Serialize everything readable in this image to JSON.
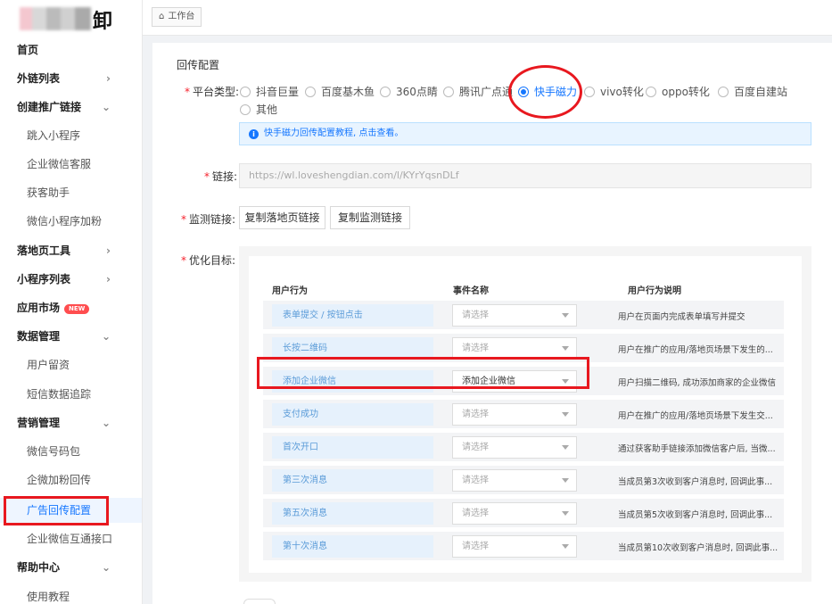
{
  "logo": {
    "text": "卸"
  },
  "header": {
    "breadcrumb_label": "工作台"
  },
  "sidebar": {
    "items": [
      {
        "label": "首页",
        "level": "top",
        "chevron": ""
      },
      {
        "label": "外链列表",
        "level": "top",
        "chevron": ">"
      },
      {
        "label": "创建推广链接",
        "level": "top",
        "chevron": "v"
      },
      {
        "label": "跳入小程序",
        "level": "sub"
      },
      {
        "label": "企业微信客服",
        "level": "sub"
      },
      {
        "label": "获客助手",
        "level": "sub"
      },
      {
        "label": "微信小程序加粉",
        "level": "sub"
      },
      {
        "label": "落地页工具",
        "level": "top",
        "chevron": ">"
      },
      {
        "label": "小程序列表",
        "level": "top",
        "chevron": ">"
      },
      {
        "label": "应用市场",
        "level": "top",
        "badge": "NEW"
      },
      {
        "label": "数据管理",
        "level": "top",
        "chevron": "v"
      },
      {
        "label": "用户留资",
        "level": "sub"
      },
      {
        "label": "短信数据追踪",
        "level": "sub"
      },
      {
        "label": "营销管理",
        "level": "top",
        "chevron": "v"
      },
      {
        "label": "微信号码包",
        "level": "sub"
      },
      {
        "label": "企微加粉回传",
        "level": "sub"
      },
      {
        "label": "广告回传配置",
        "level": "sub",
        "active": true
      },
      {
        "label": "企业微信互通接口",
        "level": "sub"
      },
      {
        "label": "帮助中心",
        "level": "top",
        "chevron": "v"
      },
      {
        "label": "使用教程",
        "level": "sub"
      }
    ]
  },
  "form": {
    "section_title": "回传配置",
    "platform_label": "平台类型:",
    "platforms": [
      {
        "label": "抖音巨量",
        "checked": false
      },
      {
        "label": "百度基木鱼",
        "checked": false
      },
      {
        "label": "360点睛",
        "checked": false
      },
      {
        "label": "腾讯广点通",
        "checked": false
      },
      {
        "label": "快手磁力",
        "checked": true
      },
      {
        "label": "vivo转化",
        "checked": false
      },
      {
        "label": "oppo转化",
        "checked": false
      },
      {
        "label": "百度自建站",
        "checked": false
      },
      {
        "label": "其他",
        "checked": false
      }
    ],
    "info_text": "快手磁力回传配置教程, 点击查看。",
    "link_label": "链接:",
    "link_value": "https://wl.loveshengdian.com/l/KYrYqsnDLf",
    "monitor_label": "监测链接:",
    "copy_landing_button": "复制落地页链接",
    "copy_monitor_button": "复制监测链接",
    "goal_label": "优化目标:"
  },
  "table": {
    "headers": [
      "用户行为",
      "事件名称",
      "用户行为说明"
    ],
    "rows": [
      {
        "behavior": "表单提交 / 按钮点击",
        "event": "请选择",
        "filled": false,
        "description": "用户在页面内完成表单填写并提交"
      },
      {
        "behavior": "长按二维码",
        "event": "请选择",
        "filled": false,
        "description": "用户在推广的应用/落地页场景下发生的..."
      },
      {
        "behavior": "添加企业微信",
        "event": "添加企业微信",
        "filled": true,
        "description": "用户扫描二维码, 成功添加商家的企业微信"
      },
      {
        "behavior": "支付成功",
        "event": "请选择",
        "filled": false,
        "description": "用户在推广的应用/落地页场景下发生交..."
      },
      {
        "behavior": "首次开口",
        "event": "请选择",
        "filled": false,
        "description": "通过获客助手链接添加微信客户后, 当微..."
      },
      {
        "behavior": "第三次消息",
        "event": "请选择",
        "filled": false,
        "description": "当成员第3次收到客户消息时, 回调此事..."
      },
      {
        "behavior": "第五次消息",
        "event": "请选择",
        "filled": false,
        "description": "当成员第5次收到客户消息时, 回调此事..."
      },
      {
        "behavior": "第十次消息",
        "event": "请选择",
        "filled": false,
        "description": "当成员第10次收到客户消息时, 回调此事..."
      }
    ]
  },
  "icons": {
    "home": "home-icon",
    "info": "info-icon",
    "caret": "caret-down-icon",
    "chevron": "chevron-icon"
  },
  "colors": {
    "accent": "#1677ff",
    "annotation_red": "#e8181f",
    "badge_red": "#ff4d4f",
    "behavior_bg": "#e6f1fc"
  }
}
